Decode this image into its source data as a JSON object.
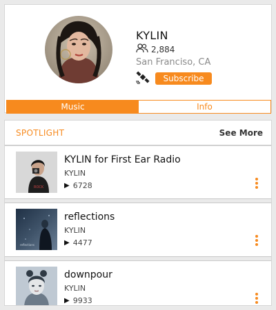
{
  "profile": {
    "name": "KYLIN",
    "followers": "2,884",
    "location": "San Franciso, CA",
    "subscribe_label": "Subscribe"
  },
  "tabs": [
    {
      "label": "Music",
      "active": true
    },
    {
      "label": "Info",
      "active": false
    }
  ],
  "spotlight": {
    "title": "SPOTLIGHT",
    "see_more": "See More",
    "tracks": [
      {
        "title": "KYLIN for First Ear Radio",
        "artist": "KYLIN",
        "plays": "6728"
      },
      {
        "title": "reflections",
        "artist": "KYLIN",
        "plays": "4477"
      },
      {
        "title": "downpour",
        "artist": "KYLIN",
        "plays": "9933"
      }
    ]
  },
  "colors": {
    "accent": "#f78a1e",
    "background": "#eaeaea",
    "card": "#ffffff"
  },
  "icons": {
    "followers": "people-icon",
    "satellite": "satellite-icon",
    "play": "play-icon",
    "more": "more-vertical-icon"
  }
}
